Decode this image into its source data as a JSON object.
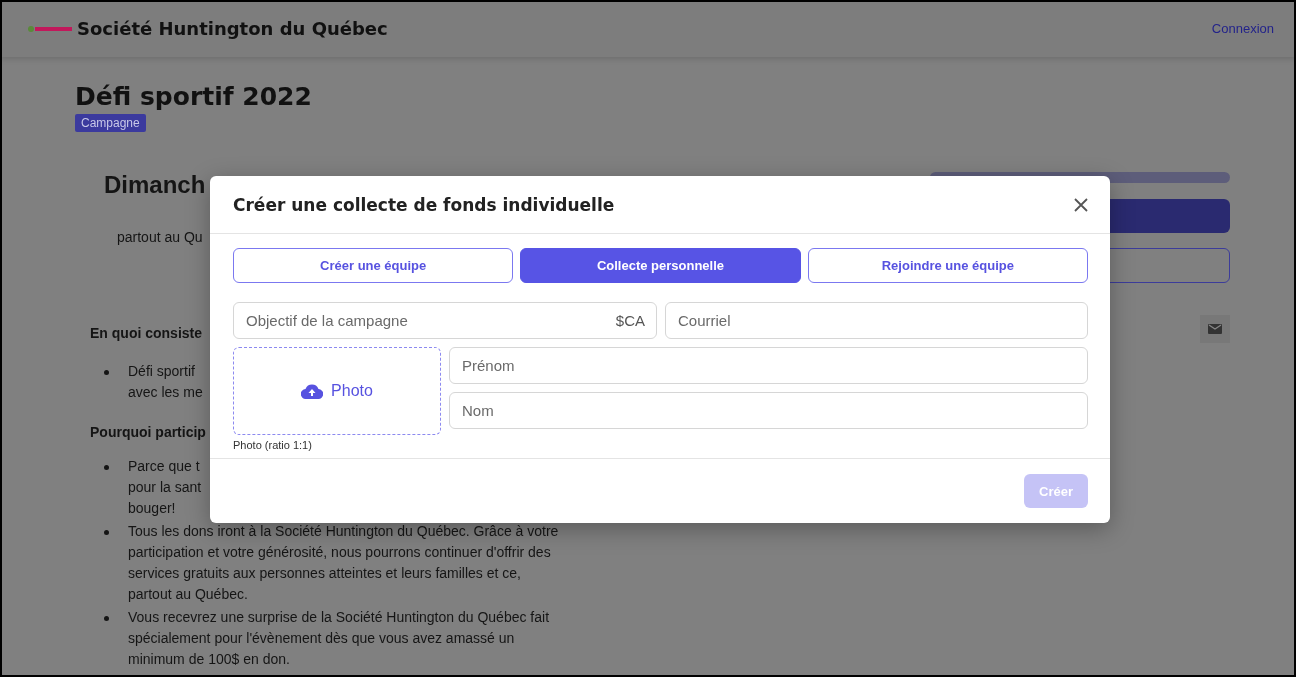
{
  "header": {
    "site_name": "Société Huntington du Québec",
    "login_link": "Connexion"
  },
  "campaign": {
    "title": "Défi sportif 2022",
    "badge": "Campagne",
    "date_heading": "Dimanch",
    "location": "partout au Qu",
    "sections": [
      {
        "heading": "En quoi consiste",
        "items": [
          {
            "lines": [
              "Défi sportif",
              "avec les me"
            ]
          }
        ]
      },
      {
        "heading": "Pourquoi particip",
        "items": [
          {
            "lines": [
              "Parce que t",
              "pour la sant",
              "bouger!"
            ]
          },
          {
            "lines": [
              "Tous les dons iront à la Société Huntington du Québec. Grâce à votre",
              "participation et votre générosité, nous pourrons continuer d'offrir des",
              "services gratuits aux personnes atteintes et leurs familles et ce,",
              "partout au Québec."
            ]
          },
          {
            "lines": [
              "Vous recevrez une surprise de la Société Huntington du Québec fait",
              "spécialement pour l'évènement dès que vous avez amassé un",
              "minimum de 100$ en don."
            ]
          }
        ]
      }
    ]
  },
  "modal": {
    "title": "Créer une collecte de fonds individuelle",
    "tabs": [
      {
        "label": "Créer une équipe",
        "selected": false
      },
      {
        "label": "Collecte personnelle",
        "selected": true
      },
      {
        "label": "Rejoindre une équipe",
        "selected": false
      }
    ],
    "goal_field": {
      "placeholder": "Objectif de la campagne",
      "suffix": "$CA"
    },
    "email_field": {
      "placeholder": "Courriel"
    },
    "photo": {
      "label": "Photo",
      "caption": "Photo (ratio 1:1)"
    },
    "first_name_field": {
      "placeholder": "Prénom"
    },
    "last_name_field": {
      "placeholder": "Nom"
    },
    "submit": {
      "label": "Créer",
      "disabled": true
    }
  }
}
